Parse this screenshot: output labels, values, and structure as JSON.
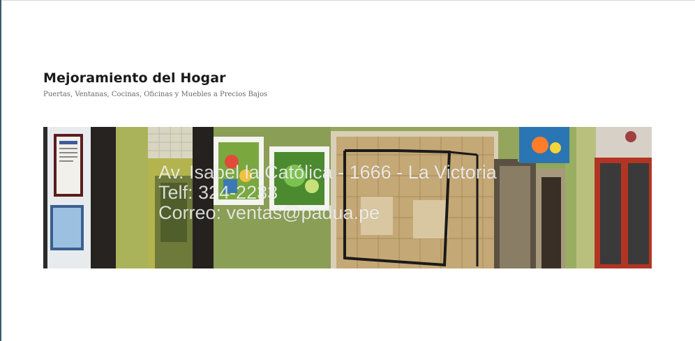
{
  "site": {
    "title": "Mejoramiento del Hogar",
    "tagline": "Puertas, Ventanas, Cocinas, Oficinas y Muebles a Precios Bajos"
  },
  "header_image": {
    "address_line": "Av. Isabel la Católica - 1666 - La Victoria",
    "phone_line": "Telf: 324-2233",
    "email_line": "Correo: ventas@padua.pe"
  },
  "colors": {
    "title": "#1a1a1a",
    "tagline": "#686868",
    "wall_green": "#8fa25a",
    "overlay_text": "#ffffff"
  }
}
